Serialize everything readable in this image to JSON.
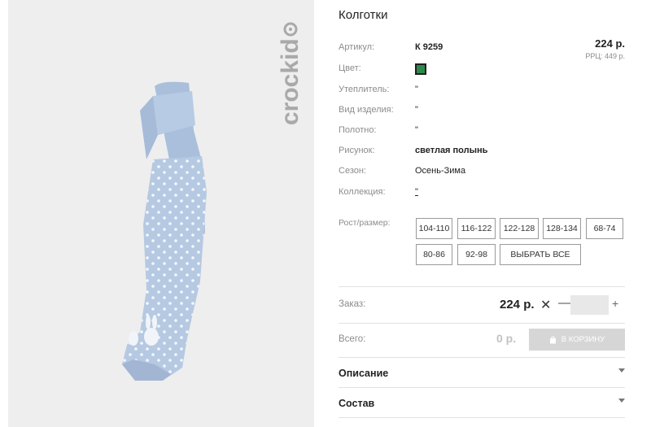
{
  "product": {
    "title": "Колготки",
    "brand": "crockid",
    "price": "224 р.",
    "rrp": "РРЦ: 449 р.",
    "color_hex": "#2c8a4d"
  },
  "attributes": [
    {
      "label": "Артикул:",
      "value": "К 9259"
    },
    {
      "label": "Цвет:",
      "value": ""
    },
    {
      "label": "Утеплитель:",
      "value": "\""
    },
    {
      "label": "Вид изделия:",
      "value": "\""
    },
    {
      "label": "Полотно:",
      "value": "\""
    },
    {
      "label": "Рисунок:",
      "value": "светлая полынь"
    },
    {
      "label": "Сезон:",
      "value": "Осень-Зима"
    },
    {
      "label": "Коллекция:",
      "value": "\""
    }
  ],
  "sizes": {
    "label": "Рост/размер:",
    "options": [
      "104-110",
      "116-122",
      "122-128",
      "128-134",
      "68-74",
      "80-86",
      "92-98"
    ],
    "select_all": "ВЫБРАТЬ ВСЕ"
  },
  "order": {
    "label": "Заказ:",
    "unit_price": "224 р.",
    "times": "✕",
    "minus": "—",
    "plus": "+",
    "quantity": ""
  },
  "total": {
    "label": "Всего:",
    "value": "0 р.",
    "cart_button": "В КОРЗИНУ"
  },
  "accordion": [
    {
      "label": "Описание"
    },
    {
      "label": "Состав"
    }
  ]
}
